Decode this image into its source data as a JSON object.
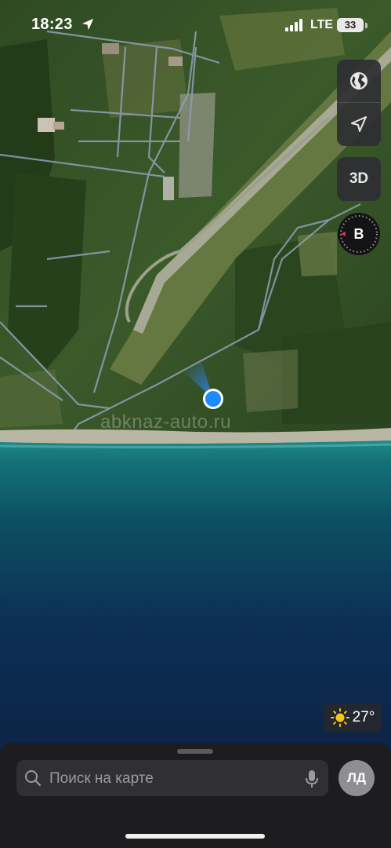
{
  "status_bar": {
    "time": "18:23",
    "network": "LTE",
    "battery": "33"
  },
  "map": {
    "type": "satellite",
    "watermark": "abknaz-auto.ru"
  },
  "controls": {
    "map_mode_icon": "globe-icon",
    "track_icon": "location-arrow-icon",
    "three_d_label": "3D",
    "compass_label": "В"
  },
  "weather": {
    "icon": "sun-icon",
    "temperature": "27°"
  },
  "bottom_sheet": {
    "search_placeholder": "Поиск на карте",
    "avatar_initials": "ЛД"
  },
  "colors": {
    "user_location": "#1a8cff",
    "compass_needle": "#e53935",
    "weather_sun": "#f5c518"
  }
}
